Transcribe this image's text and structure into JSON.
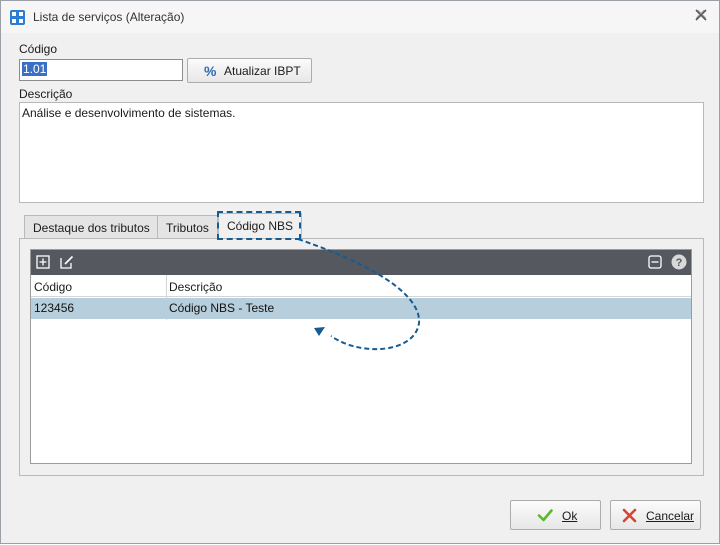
{
  "window": {
    "title": "Lista de serviços (Alteração)",
    "icon": "app-grid-icon",
    "close_icon": "close-icon"
  },
  "form": {
    "codigo_label": "Código",
    "codigo_value": "1.01",
    "ibpt_button_label": "Atualizar IBPT",
    "ibpt_icon": "percent-edit-icon",
    "descricao_label": "Descrição",
    "descricao_value": "Análise e desenvolvimento de sistemas."
  },
  "tabs": [
    {
      "label": "Destaque dos tributos",
      "active": false
    },
    {
      "label": "Tributos",
      "active": false
    },
    {
      "label": "Código NBS",
      "active": true
    }
  ],
  "grid": {
    "toolbar_icons": [
      "add-icon",
      "edit-icon",
      "collapse-icon",
      "help-icon"
    ],
    "columns": [
      "Código",
      "Descrição"
    ],
    "rows": [
      {
        "codigo": "123456",
        "descricao": "Código NBS - Teste",
        "selected": true
      }
    ]
  },
  "footer": {
    "ok_label": "Ok",
    "cancel_label": "Cancelar"
  },
  "colors": {
    "accent_highlight": "#145c91",
    "selected_row": "#b7cfdc",
    "toolbar_bg": "#55595f",
    "ok_check": "#5cb82e",
    "cancel_x": "#d9432f"
  }
}
